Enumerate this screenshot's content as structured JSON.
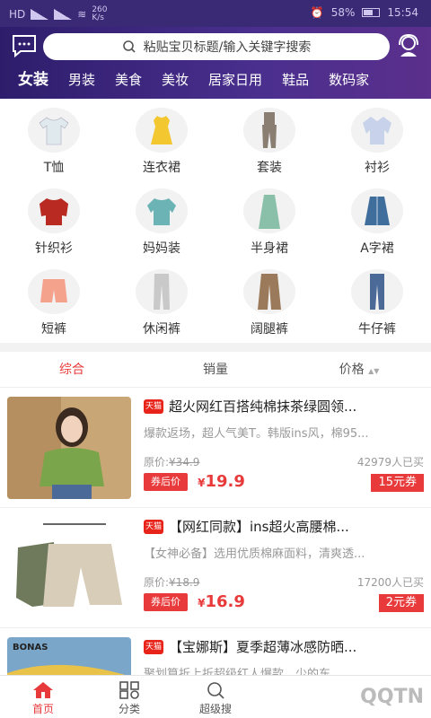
{
  "status": {
    "network": "HD",
    "speed": "260 K/s",
    "battery": "58%",
    "time": "15:54",
    "icons": [
      "signal-icon",
      "wifi-icon",
      "alarm-icon",
      "battery-icon"
    ]
  },
  "header": {
    "search_placeholder": "粘贴宝贝标题/输入关键字搜索",
    "categories": [
      "女装",
      "男装",
      "美食",
      "美妆",
      "居家日用",
      "鞋品",
      "数码家"
    ]
  },
  "subcategories": [
    {
      "label": "T恤",
      "icon": "tshirt-icon",
      "color": "#dfe9ee"
    },
    {
      "label": "连衣裙",
      "icon": "dress-icon",
      "color": "#f2c730"
    },
    {
      "label": "套装",
      "icon": "suit-icon",
      "color": "#8a7d72"
    },
    {
      "label": "衬衫",
      "icon": "shirt-icon",
      "color": "#c8d2ea"
    },
    {
      "label": "针织衫",
      "icon": "knit-icon",
      "color": "#b82a22"
    },
    {
      "label": "妈妈装",
      "icon": "mom-wear-icon",
      "color": "#6bb3b4"
    },
    {
      "label": "半身裙",
      "icon": "skirt-icon",
      "color": "#8ac0a9"
    },
    {
      "label": "A字裙",
      "icon": "a-skirt-icon",
      "color": "#3f6d9c"
    },
    {
      "label": "短裤",
      "icon": "shorts-icon",
      "color": "#f4a28c"
    },
    {
      "label": "休闲裤",
      "icon": "casual-pants-icon",
      "color": "#c9c9c9"
    },
    {
      "label": "阔腿裤",
      "icon": "wide-pants-icon",
      "color": "#9a7a5a"
    },
    {
      "label": "牛仔裤",
      "icon": "jeans-icon",
      "color": "#4b6a98"
    }
  ],
  "sort": {
    "items": [
      "综合",
      "销量",
      "价格"
    ],
    "active": "综合"
  },
  "products": [
    {
      "badge": "天猫",
      "title": "超火网红百搭纯棉抹茶绿圆领...",
      "desc": "爆款返场，超人气美T。韩版ins风，棉95...",
      "orig_price_label": "原价:",
      "orig_price": "¥34.9",
      "sold": "42979人已买",
      "coupon_price_label": "券后价",
      "price_symbol": "¥",
      "price": "19.9",
      "coupon": "15元券"
    },
    {
      "badge": "天猫",
      "title": "【网红同款】ins超火高腰棉...",
      "desc": "【女神必备】选用优质棉麻面料，清爽透...",
      "orig_price_label": "原价:",
      "orig_price": "¥18.9",
      "sold": "17200人已买",
      "coupon_price_label": "券后价",
      "price_symbol": "¥",
      "price": "16.9",
      "coupon": "2元券"
    },
    {
      "badge": "天猫",
      "title": "【宝娜斯】夏季超薄冰感防晒...",
      "desc": "聚划算折上折超级红人爆款，少的东...",
      "brand_text": "BONAS"
    }
  ],
  "tabbar": {
    "items": [
      {
        "label": "首页",
        "icon": "home-icon"
      },
      {
        "label": "分类",
        "icon": "category-icon"
      },
      {
        "label": "超级搜",
        "icon": "search-icon"
      }
    ],
    "watermark": "QQTN"
  },
  "colors": {
    "accent": "#e83a3a",
    "header": "#3d2680"
  }
}
